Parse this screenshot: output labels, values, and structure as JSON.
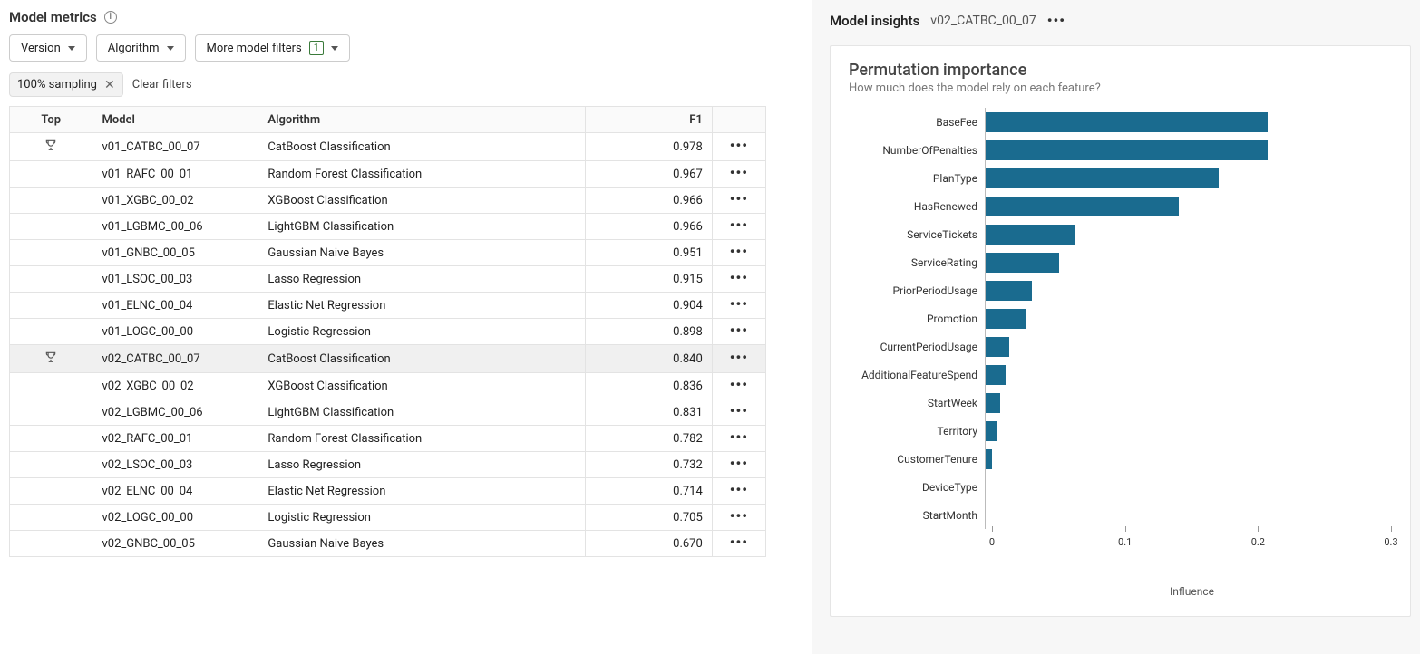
{
  "metrics": {
    "title": "Model metrics",
    "filters": {
      "version_label": "Version",
      "algorithm_label": "Algorithm",
      "more_filters_label": "More model filters",
      "more_filters_count": "1",
      "active_chip": "100% sampling",
      "clear_label": "Clear filters"
    },
    "columns": {
      "top": "Top",
      "model": "Model",
      "algorithm": "Algorithm",
      "f1": "F1"
    },
    "rows": [
      {
        "top": true,
        "model": "v01_CATBC_00_07",
        "algorithm": "CatBoost Classification",
        "f1": "0.978",
        "selected": false
      },
      {
        "top": false,
        "model": "v01_RAFC_00_01",
        "algorithm": "Random Forest Classification",
        "f1": "0.967",
        "selected": false
      },
      {
        "top": false,
        "model": "v01_XGBC_00_02",
        "algorithm": "XGBoost Classification",
        "f1": "0.966",
        "selected": false
      },
      {
        "top": false,
        "model": "v01_LGBMC_00_06",
        "algorithm": "LightGBM Classification",
        "f1": "0.966",
        "selected": false
      },
      {
        "top": false,
        "model": "v01_GNBC_00_05",
        "algorithm": "Gaussian Naive Bayes",
        "f1": "0.951",
        "selected": false
      },
      {
        "top": false,
        "model": "v01_LSOC_00_03",
        "algorithm": "Lasso Regression",
        "f1": "0.915",
        "selected": false
      },
      {
        "top": false,
        "model": "v01_ELNC_00_04",
        "algorithm": "Elastic Net Regression",
        "f1": "0.904",
        "selected": false
      },
      {
        "top": false,
        "model": "v01_LOGC_00_00",
        "algorithm": "Logistic Regression",
        "f1": "0.898",
        "selected": false
      },
      {
        "top": true,
        "model": "v02_CATBC_00_07",
        "algorithm": "CatBoost Classification",
        "f1": "0.840",
        "selected": true
      },
      {
        "top": false,
        "model": "v02_XGBC_00_02",
        "algorithm": "XGBoost Classification",
        "f1": "0.836",
        "selected": false
      },
      {
        "top": false,
        "model": "v02_LGBMC_00_06",
        "algorithm": "LightGBM Classification",
        "f1": "0.831",
        "selected": false
      },
      {
        "top": false,
        "model": "v02_RAFC_00_01",
        "algorithm": "Random Forest Classification",
        "f1": "0.782",
        "selected": false
      },
      {
        "top": false,
        "model": "v02_LSOC_00_03",
        "algorithm": "Lasso Regression",
        "f1": "0.732",
        "selected": false
      },
      {
        "top": false,
        "model": "v02_ELNC_00_04",
        "algorithm": "Elastic Net Regression",
        "f1": "0.714",
        "selected": false
      },
      {
        "top": false,
        "model": "v02_LOGC_00_00",
        "algorithm": "Logistic Regression",
        "f1": "0.705",
        "selected": false
      },
      {
        "top": false,
        "model": "v02_GNBC_00_05",
        "algorithm": "Gaussian Naive Bayes",
        "f1": "0.670",
        "selected": false
      }
    ]
  },
  "insights": {
    "title": "Model insights",
    "selected_model": "v02_CATBC_00_07",
    "card_title": "Permutation importance",
    "card_sub": "How much does the model rely on each feature?"
  },
  "chart_data": {
    "type": "bar",
    "orientation": "horizontal",
    "title": "Permutation importance",
    "xlabel": "Influence",
    "ylabel": "",
    "xlim": [
      0,
      0.3
    ],
    "ticks": [
      0,
      0.1,
      0.2,
      0.3
    ],
    "categories": [
      "BaseFee",
      "NumberOfPenalties",
      "PlanType",
      "HasRenewed",
      "ServiceTickets",
      "ServiceRating",
      "PriorPeriodUsage",
      "Promotion",
      "CurrentPeriodUsage",
      "AdditionalFeatureSpend",
      "StartWeek",
      "Territory",
      "CustomerTenure",
      "DeviceType",
      "StartMonth"
    ],
    "values": [
      0.212,
      0.212,
      0.175,
      0.145,
      0.067,
      0.055,
      0.035,
      0.03,
      0.018,
      0.015,
      0.011,
      0.008,
      0.005,
      0.0,
      0.0
    ]
  }
}
